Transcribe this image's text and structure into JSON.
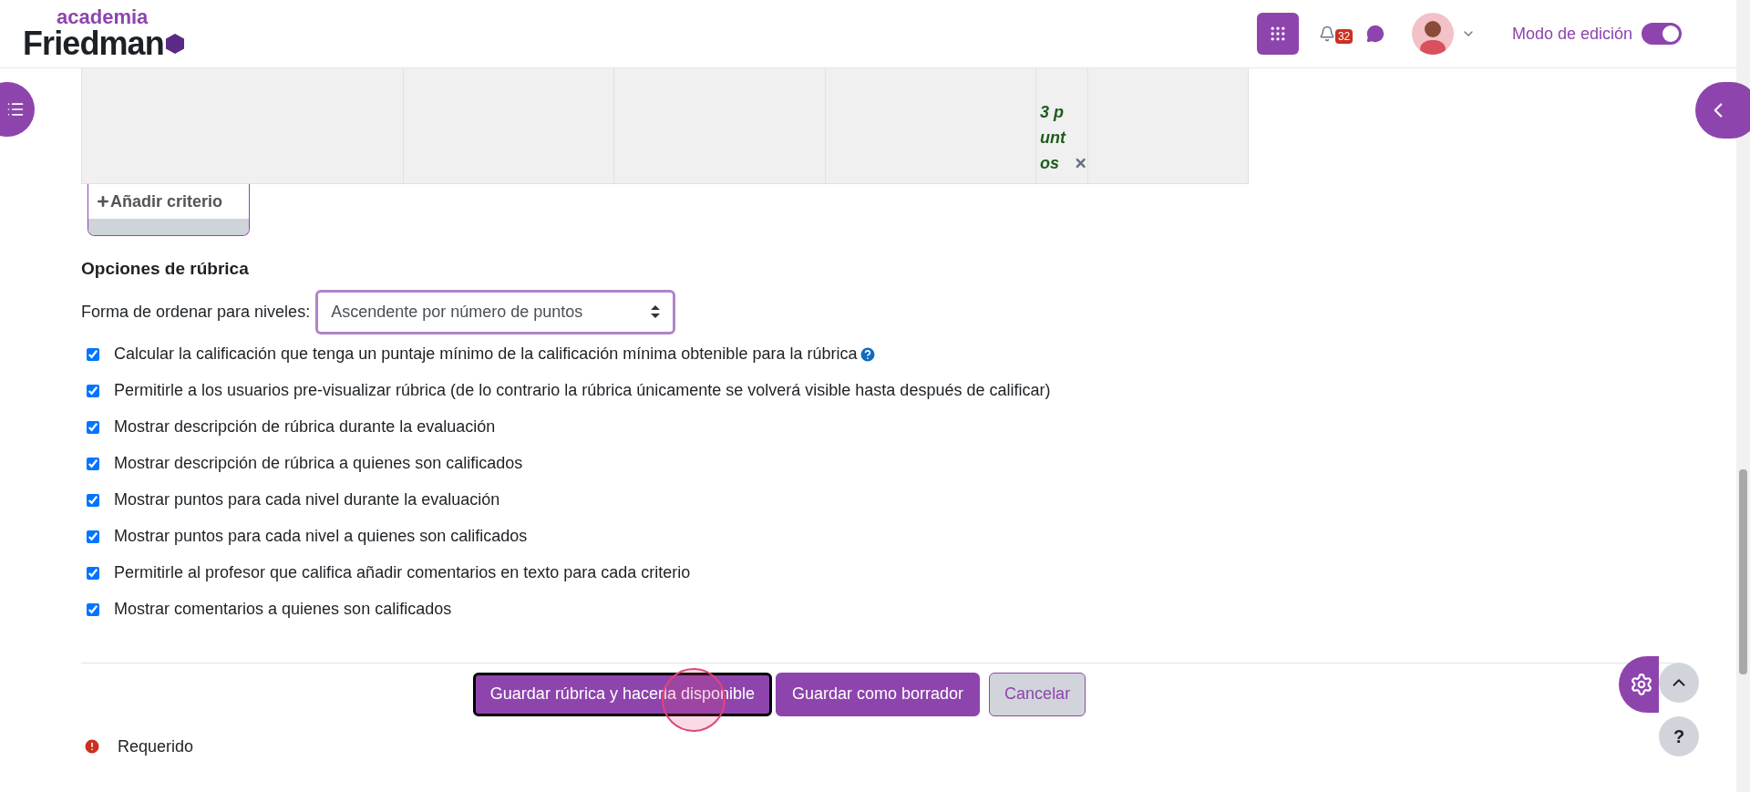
{
  "header": {
    "logo_top": "academia",
    "logo_bottom": "Friedman",
    "notifications_count": "32",
    "edit_mode": {
      "label": "Modo de edición",
      "on": true
    }
  },
  "rubric_table": {
    "points_label": "3 puntos"
  },
  "add_criterion": "Añadir criterio",
  "options": {
    "title": "Opciones de rúbrica",
    "sort_label": "Forma de ordenar para niveles:",
    "sort_value": "Ascendente por número de puntos",
    "checkboxes": [
      {
        "label": "Calcular la calificación que tenga un puntaje mínimo de la calificación mínima obtenible para la rúbrica",
        "checked": true,
        "help": true
      },
      {
        "label": "Permitirle a los usuarios pre-visualizar rúbrica (de lo contrario la rúbrica únicamente se volverá visible hasta después de calificar)",
        "checked": true,
        "help": false
      },
      {
        "label": "Mostrar descripción de rúbrica durante la evaluación",
        "checked": true,
        "help": false
      },
      {
        "label": "Mostrar descripción de rúbrica a quienes son calificados",
        "checked": true,
        "help": false
      },
      {
        "label": "Mostrar puntos para cada nivel durante la evaluación",
        "checked": true,
        "help": false
      },
      {
        "label": "Mostrar puntos para cada nivel a quienes son calificados",
        "checked": true,
        "help": false
      },
      {
        "label": "Permitirle al profesor que califica añadir comentarios en texto para cada criterio",
        "checked": true,
        "help": false
      },
      {
        "label": "Mostrar comentarios a quienes son calificados",
        "checked": true,
        "help": false
      }
    ]
  },
  "buttons": [
    {
      "label": "Guardar rúbrica y hacerla disponible",
      "kind": "primary",
      "focused": true
    },
    {
      "label": "Guardar como borrador",
      "kind": "primary",
      "focused": false
    },
    {
      "label": "Cancelar",
      "kind": "secondary",
      "focused": false
    }
  ],
  "required_note": "Requerido",
  "help_button": "?"
}
